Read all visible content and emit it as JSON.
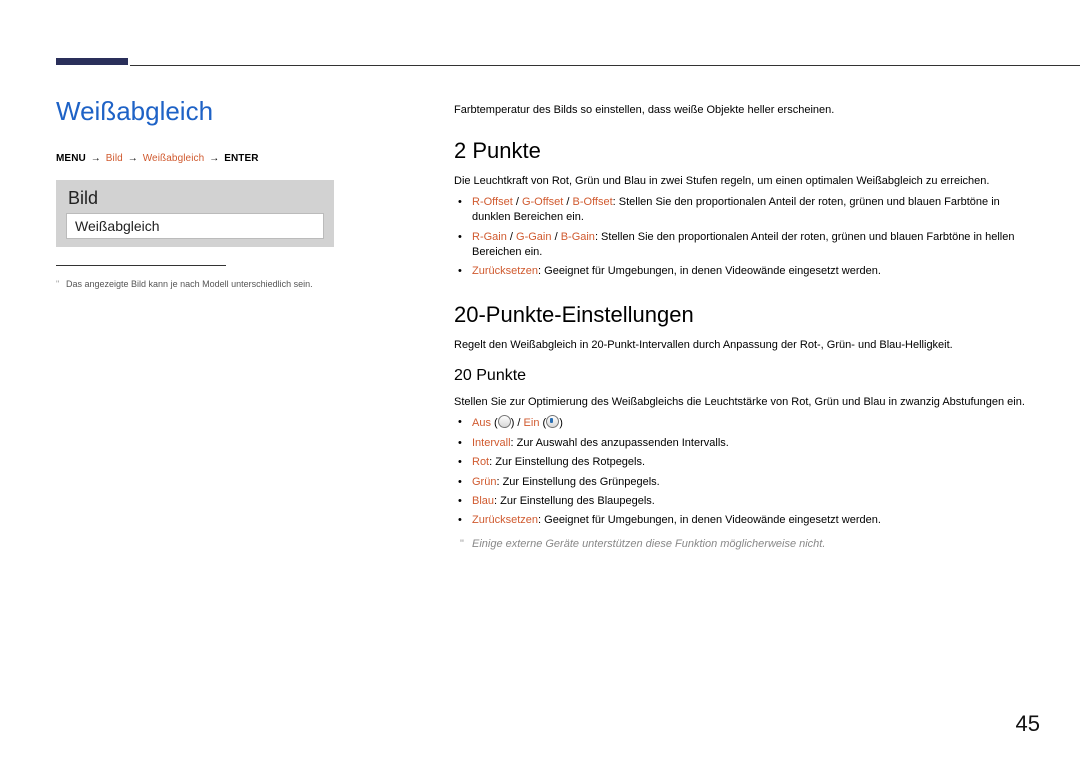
{
  "page_number": "45",
  "left": {
    "section_title": "Weißabgleich",
    "breadcrumb": {
      "menu": "MENU",
      "bild": "Bild",
      "weissabgleich": "Weißabgleich",
      "enter": "ENTER"
    },
    "mock": {
      "title": "Bild",
      "item": "Weißabgleich"
    },
    "note": "Das angezeigte Bild kann je nach Modell unterschiedlich sein."
  },
  "right": {
    "intro": "Farbtemperatur des Bilds so einstellen, dass weiße Objekte heller erscheinen.",
    "s1": {
      "heading": "2 Punkte",
      "body": "Die Leuchtkraft von Rot, Grün und Blau in zwei Stufen regeln, um einen optimalen Weißabgleich zu erreichen.",
      "b1": {
        "r": "R-Offset",
        "g": "G-Offset",
        "b": "B-Offset",
        "text": ": Stellen Sie den proportionalen Anteil der roten, grünen und blauen Farbtöne in dunklen Bereichen ein."
      },
      "b2": {
        "r": "R-Gain",
        "g": "G-Gain",
        "b": "B-Gain",
        "text": ": Stellen Sie den proportionalen Anteil der roten, grünen und blauen Farbtöne in hellen Bereichen ein."
      },
      "b3": {
        "label": "Zurücksetzen",
        "text": ": Geeignet für Umgebungen, in denen Videowände eingesetzt werden."
      }
    },
    "s2": {
      "heading": "20-Punkte-Einstellungen",
      "body": "Regelt den Weißabgleich in 20-Punkt-Intervallen durch Anpassung der Rot-, Grün- und Blau-Helligkeit.",
      "sub_heading": "20 Punkte",
      "sub_body": "Stellen Sie zur Optimierung des Weißabgleichs die Leuchtstärke von Rot, Grün und Blau in zwanzig Abstufungen ein.",
      "bullets": {
        "aus": "Aus",
        "ein": "Ein",
        "interval_label": "Intervall",
        "interval_text": ": Zur Auswahl des anzupassenden Intervalls.",
        "rot_label": "Rot",
        "rot_text": ": Zur Einstellung des Rotpegels.",
        "gruen_label": "Grün",
        "gruen_text": ": Zur Einstellung des Grünpegels.",
        "blau_label": "Blau",
        "blau_text": ": Zur Einstellung des Blaupegels.",
        "reset_label": "Zurücksetzen",
        "reset_text": ": Geeignet für Umgebungen, in denen Videowände eingesetzt werden."
      },
      "note": "Einige externe Geräte unterstützen diese Funktion möglicherweise nicht."
    }
  }
}
